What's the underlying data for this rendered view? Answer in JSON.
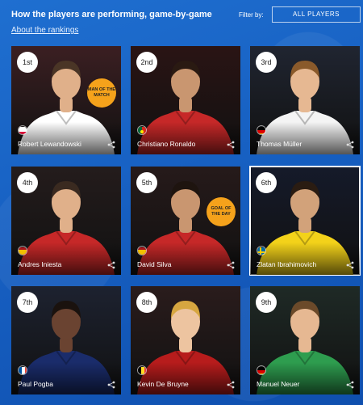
{
  "header": {
    "title": "How the players are performing, game-by-game",
    "about_link": "About the rankings",
    "filter_label": "Filter by:",
    "filter_value": "ALL PLAYERS"
  },
  "players": [
    {
      "rank": "1st",
      "name": "Robert Lewandowski",
      "flag": "poland-flag",
      "kit": "#ffffff",
      "skin": "#e0b08a",
      "hair": "#4a3526",
      "bg": "#3b1f22",
      "badge": "MAN OF THE MATCH",
      "selected": false
    },
    {
      "rank": "2nd",
      "name": "Christiano Ronaldo",
      "flag": "portugal-flag",
      "kit": "#c62828",
      "skin": "#c99670",
      "hair": "#2a1a12",
      "bg": "#2a1414",
      "badge": "",
      "selected": false
    },
    {
      "rank": "3rd",
      "name": "Thomas Müller",
      "flag": "germany-flag",
      "kit": "#f4f4f4",
      "skin": "#e6b892",
      "hair": "#8a5a2b",
      "bg": "#202531",
      "badge": "",
      "selected": false
    },
    {
      "rank": "4th",
      "name": "Andres Iniesta",
      "flag": "spain-flag",
      "kit": "#c62828",
      "skin": "#e0b08a",
      "hair": "#3a2a20",
      "bg": "#241c1c",
      "badge": "",
      "selected": false
    },
    {
      "rank": "5th",
      "name": "David Silva",
      "flag": "spain-flag",
      "kit": "#c62828",
      "skin": "#c99670",
      "hair": "#1e140f",
      "bg": "#261a1a",
      "badge": "GOAL OF THE DAY",
      "selected": false
    },
    {
      "rank": "6th",
      "name": "Zlatan Ibrahimovich",
      "flag": "sweden-flag",
      "kit": "#f3d21a",
      "skin": "#d2a27a",
      "hair": "#2a1c12",
      "bg": "#151a2a",
      "badge": "",
      "selected": true
    },
    {
      "rank": "7th",
      "name": "Paul Pogba",
      "flag": "france-flag",
      "kit": "#1a2c6b",
      "skin": "#6a4331",
      "hair": "#1a120e",
      "bg": "#1d2230",
      "badge": "",
      "selected": false
    },
    {
      "rank": "8th",
      "name": "Kevin De Bruyne",
      "flag": "belgium-flag",
      "kit": "#b71c1c",
      "skin": "#edc4a0",
      "hair": "#d6a640",
      "bg": "#2a1c1c",
      "badge": "",
      "selected": false
    },
    {
      "rank": "9th",
      "name": "Manuel Neuer",
      "flag": "germany-flag",
      "kit": "#2e9d4f",
      "skin": "#e6b892",
      "hair": "#6b4a2a",
      "bg": "#1f2a26",
      "badge": "",
      "selected": false
    }
  ]
}
